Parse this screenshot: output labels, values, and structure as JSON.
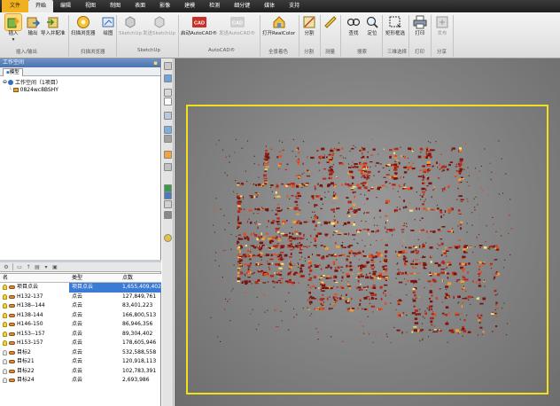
{
  "menu": {
    "tabs": [
      "文件",
      "开始",
      "编辑",
      "视图",
      "制图",
      "表面",
      "影像",
      "建模",
      "检测",
      "细分键",
      "媒体",
      "支持"
    ],
    "active": 1
  },
  "ribbon": {
    "buttons": [
      {
        "label": "插入",
        "icon": "insert-icon"
      },
      {
        "label": "输出",
        "icon": "export-icon"
      },
      {
        "label": "导入并配准",
        "icon": "import-register-icon"
      },
      {
        "label": "扫描浏览器",
        "icon": "scan-browser-icon"
      },
      {
        "label": "绘图",
        "icon": "draw-icon"
      },
      {
        "label": "SketchUp",
        "icon": "sketchup-icon"
      },
      {
        "label": "发送SketchUp",
        "icon": "sketchup-send-icon"
      },
      {
        "label": "启动AutoCAD®",
        "icon": "autocad-launch-icon"
      },
      {
        "label": "发送AutoCAD®",
        "icon": "autocad-send-icon"
      },
      {
        "label": "打开RealColor",
        "icon": "realcolor-icon"
      },
      {
        "label": "分割",
        "icon": "split-icon"
      },
      {
        "label": "",
        "icon": "measure-icon"
      },
      {
        "label": "查找",
        "icon": "find-icon"
      },
      {
        "label": "定位",
        "icon": "locate-icon"
      },
      {
        "label": "矩形框选",
        "icon": "rect-select-icon"
      },
      {
        "label": "打印",
        "icon": "print-icon"
      },
      {
        "label": "发布",
        "icon": "publish-icon"
      }
    ],
    "groups": [
      "插入/输出",
      "扫描浏览器",
      "SketchUp",
      "AutoCAD®",
      "全景着色",
      "分割",
      "测量",
      "搜索",
      "三维选择",
      "打印",
      "分享"
    ]
  },
  "left_panel": {
    "title": "工作空间",
    "tab": "模型",
    "tree": {
      "root": "工作空间（1项目）",
      "project": "0824wc8BSHY"
    }
  },
  "table": {
    "headers": [
      "名",
      "类型",
      "点数"
    ],
    "rows": [
      {
        "name": "项目点云",
        "type": "项目点云",
        "count": "1,655,409,402",
        "selected": true,
        "light": true
      },
      {
        "name": "H132-137",
        "type": "点云",
        "count": "127,849,761",
        "light": true
      },
      {
        "name": "H138--144",
        "type": "点云",
        "count": "83,401,223",
        "light": true
      },
      {
        "name": "H138-144",
        "type": "点云",
        "count": "166,800,513",
        "light": true
      },
      {
        "name": "H146-150",
        "type": "点云",
        "count": "86,946,356",
        "light": true
      },
      {
        "name": "H153--157",
        "type": "点云",
        "count": "89,304,402",
        "light": true
      },
      {
        "name": "H153-157",
        "type": "点云",
        "count": "178,605,946",
        "light": true
      },
      {
        "name": "目标2",
        "type": "点云",
        "count": "532,588,558",
        "light": false
      },
      {
        "name": "目标21",
        "type": "点云",
        "count": "120,918,113",
        "light": false
      },
      {
        "name": "目标22",
        "type": "点云",
        "count": "102,783,391",
        "light": false
      },
      {
        "name": "目标24",
        "type": "点云",
        "count": "2,693,986",
        "light": false
      }
    ]
  },
  "viewport": {
    "frame_color": "#f2e01a",
    "cloud_colors": [
      "#7a1410",
      "#b8281a",
      "#e0501e",
      "#f0a030",
      "#ffe070"
    ]
  }
}
